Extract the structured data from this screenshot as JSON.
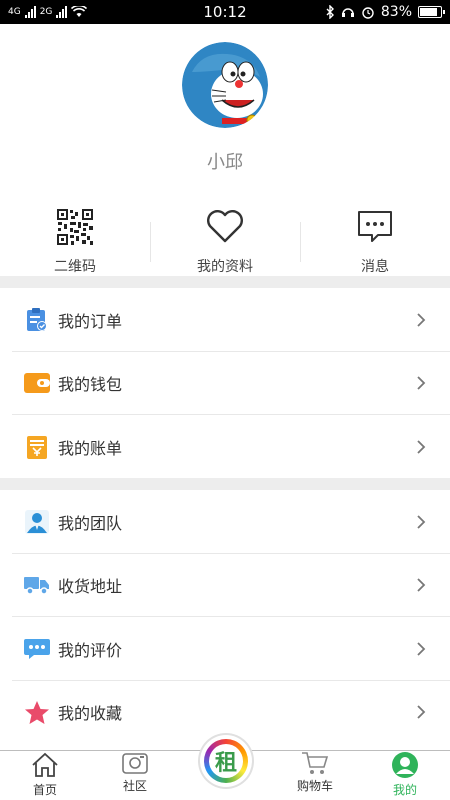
{
  "status_bar": {
    "network_1": "4G",
    "network_2": "2G",
    "time": "10:12",
    "battery": "83%",
    "battery_level": 0.83
  },
  "profile": {
    "avatar_icon": "doraemon-avatar",
    "username": "小邱"
  },
  "quick_actions": [
    {
      "label": "二维码",
      "icon": "qr-code-icon"
    },
    {
      "label": "我的资料",
      "icon": "heart-icon"
    },
    {
      "label": "消息",
      "icon": "message-icon"
    }
  ],
  "menu_group_1": [
    {
      "label": "我的订单",
      "icon": "clipboard-check-icon",
      "color": "#4a90e2"
    },
    {
      "label": "我的钱包",
      "icon": "wallet-icon",
      "color": "#f5a623"
    },
    {
      "label": "我的账单",
      "icon": "bill-icon",
      "color": "#f5a623"
    }
  ],
  "menu_group_2": [
    {
      "label": "我的团队",
      "icon": "team-user-icon",
      "color": "#2a8fd6"
    },
    {
      "label": "收货地址",
      "icon": "truck-icon",
      "color": "#5fa7e8"
    },
    {
      "label": "我的评价",
      "icon": "comment-icon",
      "color": "#4aa3ea"
    },
    {
      "label": "我的收藏",
      "icon": "star-icon",
      "color": "#e94b6a"
    }
  ],
  "tabbar": {
    "items": [
      {
        "label": "首页",
        "icon": "home-icon"
      },
      {
        "label": "社区",
        "icon": "camera-icon"
      },
      {
        "label": "购物车",
        "icon": "cart-icon"
      },
      {
        "label": "我的",
        "icon": "user-circle-icon",
        "active": true
      }
    ],
    "center_label": "租",
    "accent_color": "#2fb35a"
  }
}
